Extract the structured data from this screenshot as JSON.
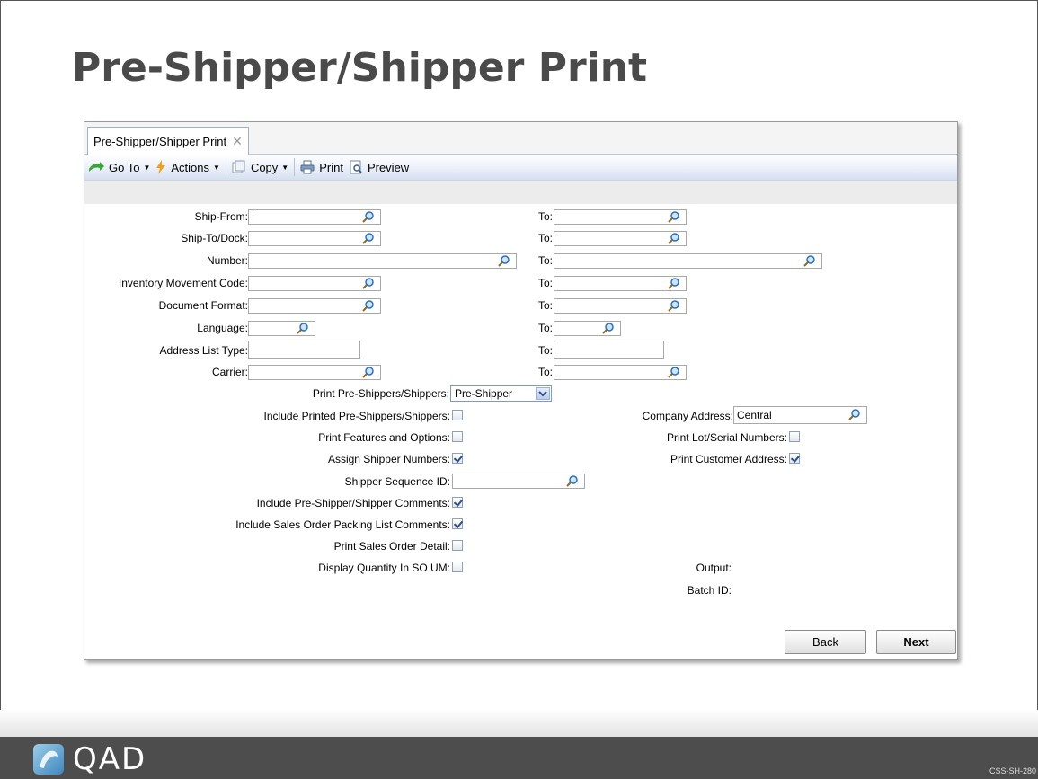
{
  "slide": {
    "title": "Pre-Shipper/Shipper Print",
    "code": "CSS-SH-280",
    "logo_text": "QAD"
  },
  "tab": {
    "label": "Pre-Shipper/Shipper Print"
  },
  "toolbar": {
    "goto": "Go To",
    "actions": "Actions",
    "copy": "Copy",
    "print": "Print",
    "preview": "Preview"
  },
  "form": {
    "ship_from": "Ship-From:",
    "ship_to_dock": "Ship-To/Dock:",
    "number": "Number:",
    "inv_move_code": "Inventory Movement Code:",
    "doc_format": "Document Format:",
    "language": "Language:",
    "addr_list_type": "Address List Type:",
    "carrier": "Carrier:",
    "to": "To:",
    "print_ps": "Print Pre-Shippers/Shippers:",
    "print_ps_value": "Pre-Shipper",
    "include_printed": "Include Printed Pre-Shippers/Shippers:",
    "print_features": "Print Features and Options:",
    "assign_numbers": "Assign Shipper Numbers:",
    "seq_id": "Shipper Sequence ID:",
    "include_comments": "Include Pre-Shipper/Shipper Comments:",
    "include_so_comments": "Include Sales Order Packing List Comments:",
    "print_so_detail": "Print Sales Order Detail:",
    "display_qty": "Display Quantity In SO UM:",
    "company_address": "Company Address:",
    "company_address_value": "Central",
    "print_lot": "Print Lot/Serial Numbers:",
    "print_cust_addr": "Print Customer Address:",
    "output": "Output:",
    "batch_id": "Batch ID:"
  },
  "checks": {
    "include_printed": false,
    "print_features": false,
    "assign_numbers": true,
    "include_comments": true,
    "include_so_comments": true,
    "print_so_detail": false,
    "display_qty": false,
    "print_lot": false,
    "print_cust_addr": true
  },
  "buttons": {
    "back": "Back",
    "next": "Next"
  }
}
